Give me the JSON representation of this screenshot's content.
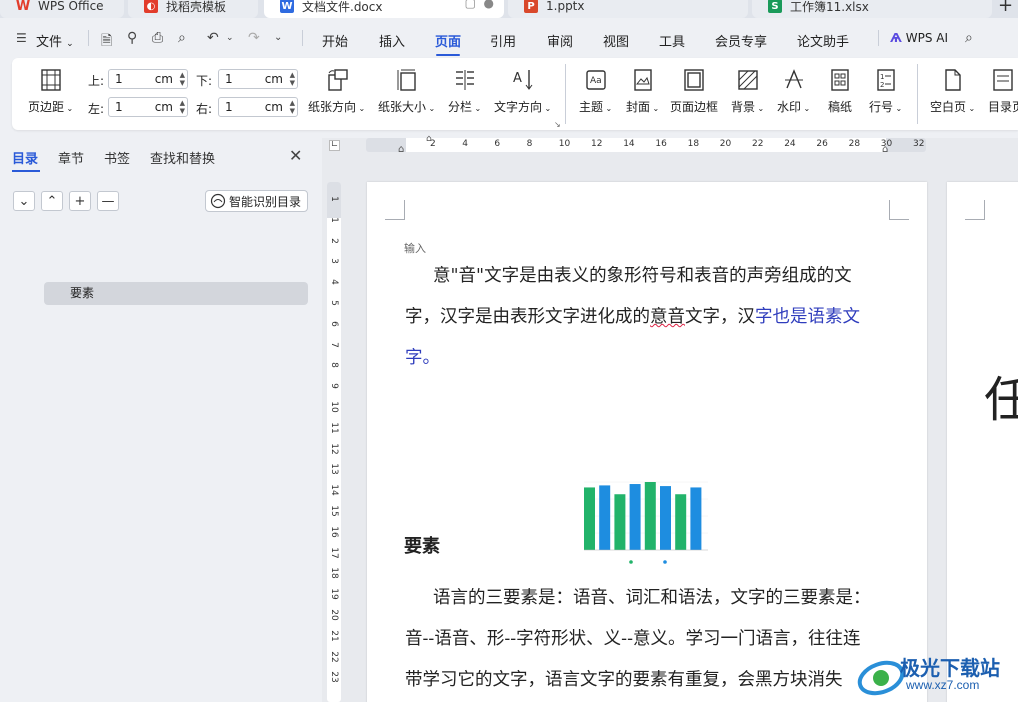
{
  "tabs": [
    {
      "label": "WPS Office",
      "icon": "wps-logo-icon",
      "color": "#e23c2b"
    },
    {
      "label": "找稻壳模板",
      "icon": "docer-icon",
      "color": "#e23c2b"
    },
    {
      "label": "文档文件.docx",
      "icon": "W",
      "color": "#2f6be0"
    },
    {
      "label": "1.pptx",
      "icon": "P",
      "color": "#d9482b"
    },
    {
      "label": "工作簿11.xlsx",
      "icon": "S",
      "color": "#1a9a5a"
    }
  ],
  "menu": {
    "file": "文件",
    "items": [
      "开始",
      "插入",
      "页面",
      "引用",
      "审阅",
      "视图",
      "工具",
      "会员专享",
      "论文助手"
    ],
    "active": "页面",
    "wps_ai": "WPS AI"
  },
  "ribbon": {
    "margins": "页边距",
    "top_label": "上:",
    "bottom_label": "下:",
    "left_label": "左:",
    "right_label": "右:",
    "top_value": "1",
    "bottom_value": "1",
    "left_value": "1",
    "right_value": "1",
    "unit": "cm",
    "orientation": "纸张方向",
    "size": "纸张大小",
    "columns": "分栏",
    "text_direction": "文字方向",
    "theme": "主题",
    "cover": "封面",
    "page_border": "页面边框",
    "background": "背景",
    "watermark": "水印",
    "manuscript": "稿纸",
    "line_number": "行号",
    "blank_page": "空白页",
    "toc_page": "目录页"
  },
  "nav": {
    "tabs": [
      "目录",
      "章节",
      "书签",
      "查找和替换"
    ],
    "active_tab": "目录",
    "smart_toc": "智能识别目录",
    "toc_items": [
      "要素"
    ]
  },
  "ruler": {
    "h_ticks": [
      "2",
      "4",
      "6",
      "8",
      "10",
      "12",
      "14",
      "16",
      "18",
      "20",
      "22",
      "24",
      "26",
      "28",
      "30",
      "32"
    ],
    "v_ticks": [
      "1",
      "1",
      "2",
      "3",
      "4",
      "5",
      "6",
      "7",
      "8",
      "9",
      "10",
      "11",
      "12",
      "13",
      "14",
      "15",
      "16",
      "17",
      "18",
      "19",
      "20",
      "21",
      "22",
      "23"
    ]
  },
  "document": {
    "hint": "输入",
    "p1_line1": "意\"音\"文字是由表义的象形符号和表音的声旁组成的文",
    "p1_line2_a": "字，汉字是由表形文字进化成的",
    "p1_line2_b": "意音",
    "p1_line2_c": "文字，汉",
    "p1_line2_d": "字也是语素文",
    "p1_line3": "字。",
    "heading": "要素",
    "p2_line1": "语言的三要素是：语音、词汇和语法，文字的三要素是：",
    "p2_line2": "音--语音、形--字符形状、义--意义。学习一门语言，往往连",
    "p2_line3": "带学习它的文字，语言文字的要素有重复，会黑方块消失",
    "page2_char": "任"
  },
  "chart_data": {
    "type": "bar",
    "categories": [
      "",
      "",
      "",
      "",
      "",
      "",
      "",
      "",
      ""
    ],
    "values": [
      0.92,
      0.95,
      0.82,
      0.97,
      1.0,
      0.94,
      0.82,
      0.92,
      0.0
    ],
    "colors": [
      "#22b36a",
      "#1e8de0",
      "#22b36a",
      "#1e8de0",
      "#22b36a",
      "#1e8de0",
      "#22b36a",
      "#1e8de0"
    ],
    "ylim": [
      0,
      1
    ]
  },
  "watermark": {
    "text_cn": "极光下载站",
    "text_url": "www.xz7.com"
  }
}
